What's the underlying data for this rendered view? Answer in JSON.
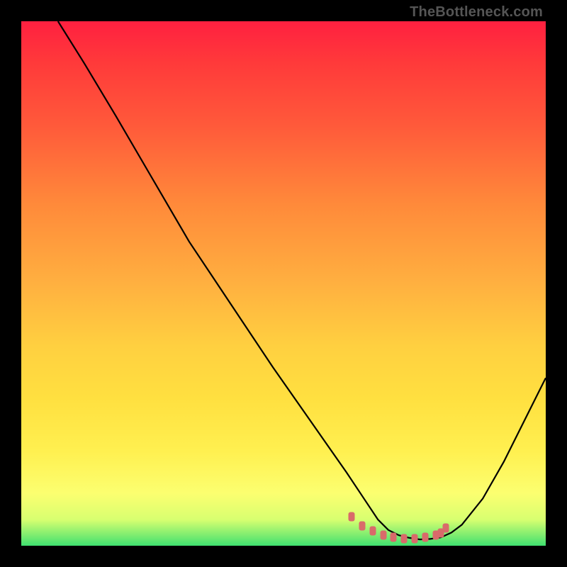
{
  "watermark": "TheBottleneck.com",
  "chart_data": {
    "type": "line",
    "title": "",
    "xlabel": "",
    "ylabel": "",
    "xlim": [
      0,
      100
    ],
    "ylim": [
      0,
      100
    ],
    "grid": false,
    "legend": false,
    "series": [
      {
        "name": "curve",
        "x": [
          7,
          12,
          18,
          25,
          32,
          40,
          48,
          55,
          62,
          66,
          68,
          70,
          72,
          74,
          76,
          78,
          80,
          82,
          84,
          88,
          92,
          96,
          100
        ],
        "y": [
          100,
          92,
          82,
          70,
          58,
          46,
          34,
          24,
          14,
          8,
          5,
          3,
          2,
          1.5,
          1.2,
          1.3,
          1.6,
          2.5,
          4,
          9,
          16,
          24,
          32
        ]
      }
    ],
    "markers": {
      "name": "highlight-points",
      "color": "#d96a6a",
      "x": [
        63,
        65,
        67,
        69,
        71,
        73,
        75,
        77,
        79,
        80,
        81
      ],
      "y": [
        5.5,
        3.8,
        2.8,
        2.0,
        1.6,
        1.4,
        1.4,
        1.6,
        2.0,
        2.4,
        3.4
      ]
    }
  }
}
